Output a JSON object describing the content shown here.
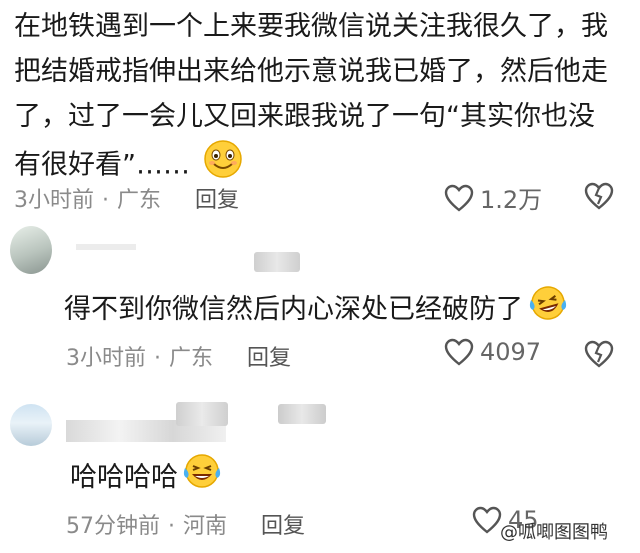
{
  "post": {
    "text": "在地铁遇到一个上来要我微信说关注我很久了，我把结婚戒指伸出来给他示意说我已婚了，然后他走了，过了一会儿又回来跟我说了一句“其实你也没有很好看”……",
    "time": "3小时前",
    "location": "广东",
    "reply_label": "回复",
    "likes": "1.2万"
  },
  "comments": [
    {
      "text": "得不到你微信然后内心深处已经破防了",
      "time": "3小时前",
      "location": "广东",
      "reply_label": "回复",
      "likes": "4097"
    },
    {
      "text": "哈哈哈哈",
      "time": "57分钟前",
      "location": "河南",
      "reply_label": "回复",
      "likes": "45"
    }
  ],
  "watermark": {
    "text": "@呱唧图图鸭"
  },
  "colors": {
    "text": "#1a1a1a",
    "meta": "#8a8a8a",
    "icon": "#555555"
  }
}
